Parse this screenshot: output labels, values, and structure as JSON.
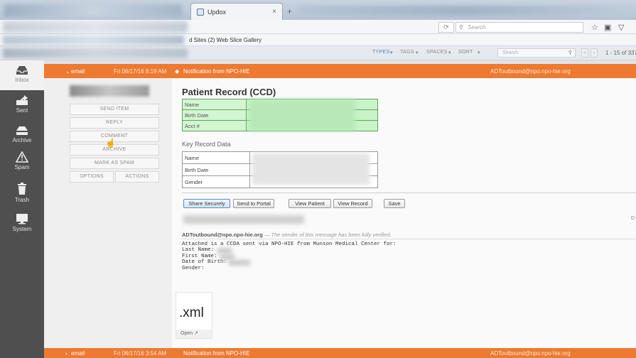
{
  "browser": {
    "tab_title": "Updox",
    "tab_close": "×",
    "new_tab": "+",
    "search_placeholder": "Search",
    "bookmarks_text": "d Sites (2)  Web Slice Gallery"
  },
  "toolbar": {
    "types": "TYPES",
    "tags": "TAGS",
    "spaces": "SPACES",
    "sort": "SORT",
    "search_placeholder": "Search",
    "page_count": "1 - 15 of 337"
  },
  "nav": [
    {
      "label": "Inbox",
      "icon": "inbox-icon"
    },
    {
      "label": "Sent",
      "icon": "sent-icon"
    },
    {
      "label": "Archive",
      "icon": "archive-icon"
    },
    {
      "label": "Spam",
      "icon": "spam-icon"
    },
    {
      "label": "Trash",
      "icon": "trash-icon"
    },
    {
      "label": "System",
      "icon": "system-icon"
    }
  ],
  "rows": [
    {
      "type": "email",
      "date": "Fri 06/17/16 8:19 AM",
      "subject": "Notification from NPO-HIE",
      "from": "ADToutbound@npo.npo-hie.org"
    },
    {
      "type": "email",
      "date": "Fri 06/17/16 3:54 AM",
      "subject": "Notification from NPO-HIE",
      "from": "ADToutbound@npo.npo-hie.org"
    }
  ],
  "actions": {
    "send_item": "SEND ITEM",
    "reply": "REPLY",
    "comment": "COMMENT",
    "archive": "ARCHIVE",
    "mark_as_spam": "MARK AS SPAM",
    "options": "OPTIONS",
    "actions": "ACTIONS"
  },
  "record": {
    "title": "Patient Record (CCD)",
    "fields": [
      "Name",
      "Birth Date",
      "Acct #"
    ],
    "key_title": "Key Record Data",
    "key_fields": [
      "Name",
      "Birth Date",
      "Gender"
    ]
  },
  "message_buttons": {
    "share": "Share Securely",
    "portal": "Send to Portal",
    "view_patient": "View Patient",
    "view_record": "View Record",
    "save": "Save"
  },
  "sender": {
    "address": "ADToutbound@npo.npo-hie.org",
    "verified": "— The sender of this message has been fully verified."
  },
  "body_text": "Attached is a CCDA sent via NPO-HIE from Munson Medical Center for:\nLast Name: \nFirst Name: \nDate of Birth: \nGender: ",
  "attachment": {
    "ext": ".xml",
    "open_label": "Open"
  },
  "edge_letter": "D",
  "colors": {
    "accent": "#ed7a30",
    "nav_bg": "#4f4f4f",
    "record_green": "#c8f4c8"
  }
}
